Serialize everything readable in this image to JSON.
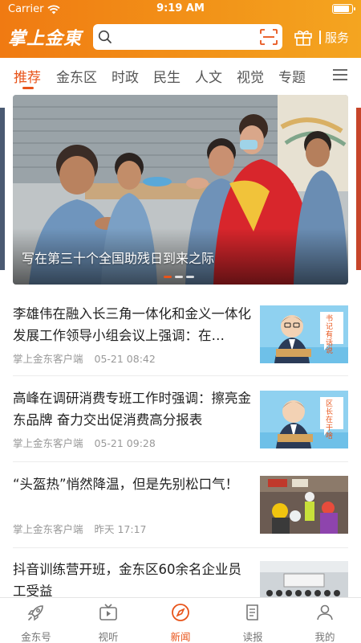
{
  "status_bar": {
    "carrier": "Carrier",
    "time": "9:19 AM"
  },
  "header": {
    "logo_text": "掌上金東",
    "search_placeholder": "",
    "service_label": "服务",
    "accent": "#f07a12"
  },
  "tabs": [
    {
      "label": "推荐",
      "active": true
    },
    {
      "label": "金东区"
    },
    {
      "label": "时政"
    },
    {
      "label": "民生"
    },
    {
      "label": "人文"
    },
    {
      "label": "视觉"
    },
    {
      "label": "专题"
    }
  ],
  "banner": {
    "caption": "写在第三十个全国助残日到来之际",
    "dots": 3,
    "active_dot": 0
  },
  "news": [
    {
      "title": "李雄伟在融入长三角一体化和金义一体化发展工作领导小组会议上强调：在…",
      "source": "掌上金东客户端",
      "time": "05-21  08:42",
      "thumb_text": "书记有话说"
    },
    {
      "title": "高峰在调研消费专班工作时强调：擦亮金东品牌 奋力交出促消费高分报表",
      "source": "掌上金东客户端",
      "time": "05-21  09:28",
      "thumb_text": "区长在干啥"
    },
    {
      "title": "“头盔热”悄然降温，但是先别松口气！",
      "source": "掌上金东客户端",
      "time": "昨天  17:17",
      "thumb_text": ""
    },
    {
      "title": "抖音训练营开班，金东区60余名企业员工受益",
      "source": "",
      "time": "",
      "thumb_text": ""
    }
  ],
  "bottom_nav": [
    {
      "label": "金东号",
      "icon": "rocket-icon"
    },
    {
      "label": "视听",
      "icon": "tv-icon"
    },
    {
      "label": "新闻",
      "icon": "compass-icon",
      "active": true
    },
    {
      "label": "读报",
      "icon": "newspaper-icon"
    },
    {
      "label": "我的",
      "icon": "user-icon"
    }
  ]
}
